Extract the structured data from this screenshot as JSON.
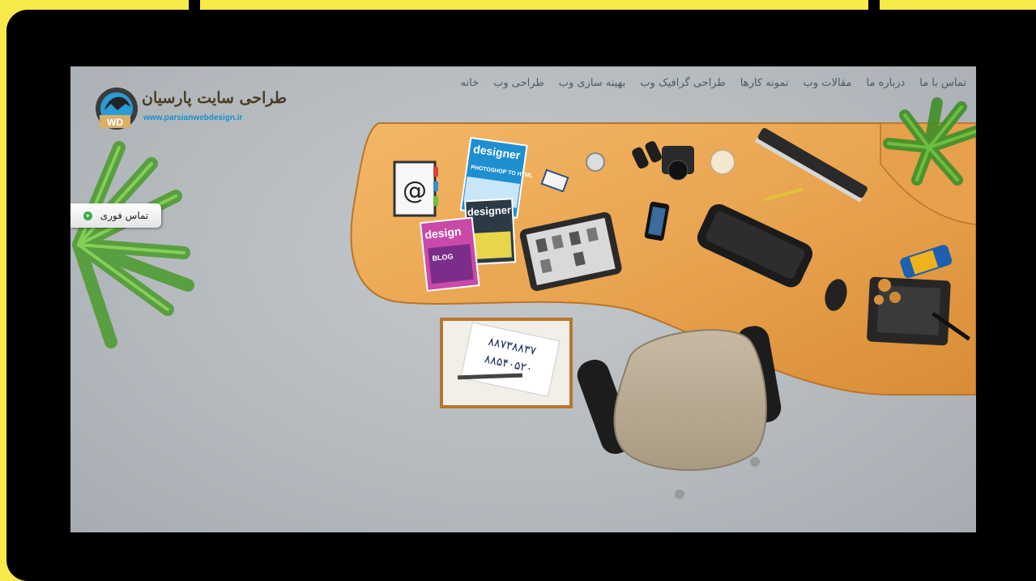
{
  "nav": {
    "items": [
      "خانه",
      "طراحی وب",
      "بهینه سازی وب",
      "طراحی گرافیک وب",
      "نمونه کارها",
      "مقالات وب",
      "درباره ما",
      "تماس با ما"
    ]
  },
  "logo": {
    "title": "طراحی سایت پارسیان",
    "url": "www.parsianwebdesign.ir",
    "monogram": "WD"
  },
  "quick_contact": {
    "label": "تماس فوری"
  },
  "desk": {
    "note_phone_1": "۸۸۷۳۸۸۳۷",
    "note_phone_2": "۸۸۵۴۰۵۲۰",
    "magazine_1": "designer",
    "magazine_1_sub": "PHOTOSHOP TO HTML",
    "magazine_2": "designer",
    "magazine_3": "design",
    "magazine_3_sub": "BLOG",
    "notebook_symbol": "@"
  },
  "colors": {
    "frame": "#f7e94a",
    "desk": "#e8a24e",
    "background": "#b3b9bd",
    "nav_text": "#4f5a62",
    "logo_url": "#1a8fc9"
  }
}
